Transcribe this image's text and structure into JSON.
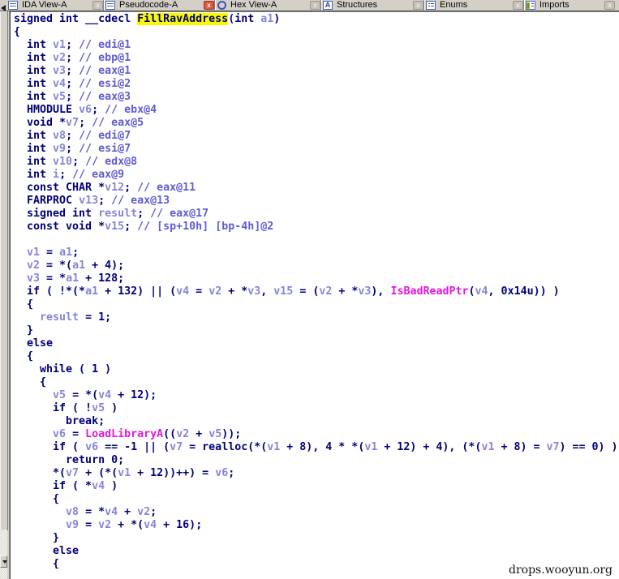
{
  "watermark": "drops.wooyun.org",
  "colors": {
    "keyword": "#00007a",
    "variable": "#8784d8",
    "comment": "#5f5dd0",
    "import_func": "#e018e0",
    "highlight_bg": "#fbfb00",
    "tab_bg": "#d4d0c8",
    "code_bg": "#ffffff",
    "active_close": "#e2573f"
  },
  "tabs": [
    {
      "label": "IDA View-A",
      "icon": "doc-lines-icon",
      "close": "x",
      "active": false
    },
    {
      "label": "Pseudocode-A",
      "icon": "doc-lines-icon",
      "close": "x",
      "active": true
    },
    {
      "label": "Hex View-A",
      "icon": "hex-ring-icon",
      "close": "x",
      "active": false
    },
    {
      "label": "Structures",
      "icon": "structures-icon",
      "close": "x",
      "active": false
    },
    {
      "label": "Enums",
      "icon": "enum-list-icon",
      "close": "x",
      "active": false
    },
    {
      "label": "Imports",
      "icon": "imports-icon",
      "close": "x",
      "active": false
    }
  ],
  "function_name": "FillRavAddress",
  "code": {
    "lines": [
      [
        [
          "k",
          "signed int __cdecl "
        ],
        [
          "h",
          "FillRavAddress"
        ],
        [
          "k",
          "(int "
        ],
        [
          "v",
          "a1"
        ],
        [
          "k",
          ")"
        ]
      ],
      [
        [
          "k",
          "{"
        ]
      ],
      [
        [
          "k",
          "  int "
        ],
        [
          "v",
          "v1"
        ],
        [
          "k",
          "; "
        ],
        [
          "c",
          "// edi@1"
        ]
      ],
      [
        [
          "k",
          "  int "
        ],
        [
          "v",
          "v2"
        ],
        [
          "k",
          "; "
        ],
        [
          "c",
          "// ebp@1"
        ]
      ],
      [
        [
          "k",
          "  int "
        ],
        [
          "v",
          "v3"
        ],
        [
          "k",
          "; "
        ],
        [
          "c",
          "// eax@1"
        ]
      ],
      [
        [
          "k",
          "  int "
        ],
        [
          "v",
          "v4"
        ],
        [
          "k",
          "; "
        ],
        [
          "c",
          "// esi@2"
        ]
      ],
      [
        [
          "k",
          "  int "
        ],
        [
          "v",
          "v5"
        ],
        [
          "k",
          "; "
        ],
        [
          "c",
          "// eax@3"
        ]
      ],
      [
        [
          "k",
          "  HMODULE "
        ],
        [
          "v",
          "v6"
        ],
        [
          "k",
          "; "
        ],
        [
          "c",
          "// ebx@4"
        ]
      ],
      [
        [
          "k",
          "  void *"
        ],
        [
          "v",
          "v7"
        ],
        [
          "k",
          "; "
        ],
        [
          "c",
          "// eax@5"
        ]
      ],
      [
        [
          "k",
          "  int "
        ],
        [
          "v",
          "v8"
        ],
        [
          "k",
          "; "
        ],
        [
          "c",
          "// edi@7"
        ]
      ],
      [
        [
          "k",
          "  int "
        ],
        [
          "v",
          "v9"
        ],
        [
          "k",
          "; "
        ],
        [
          "c",
          "// esi@7"
        ]
      ],
      [
        [
          "k",
          "  int "
        ],
        [
          "v",
          "v10"
        ],
        [
          "k",
          "; "
        ],
        [
          "c",
          "// edx@8"
        ]
      ],
      [
        [
          "k",
          "  int "
        ],
        [
          "v",
          "i"
        ],
        [
          "k",
          "; "
        ],
        [
          "c",
          "// eax@9"
        ]
      ],
      [
        [
          "k",
          "  const CHAR *"
        ],
        [
          "v",
          "v12"
        ],
        [
          "k",
          "; "
        ],
        [
          "c",
          "// eax@11"
        ]
      ],
      [
        [
          "k",
          "  FARPROC "
        ],
        [
          "v",
          "v13"
        ],
        [
          "k",
          "; "
        ],
        [
          "c",
          "// eax@13"
        ]
      ],
      [
        [
          "k",
          "  signed int "
        ],
        [
          "v",
          "result"
        ],
        [
          "k",
          "; "
        ],
        [
          "c",
          "// eax@17"
        ]
      ],
      [
        [
          "k",
          "  const void *"
        ],
        [
          "v",
          "v15"
        ],
        [
          "k",
          "; "
        ],
        [
          "c",
          "// [sp+10h] [bp-4h]@2"
        ]
      ],
      [],
      [
        [
          "k",
          "  "
        ],
        [
          "v",
          "v1"
        ],
        [
          "k",
          " = "
        ],
        [
          "v",
          "a1"
        ],
        [
          "k",
          ";"
        ]
      ],
      [
        [
          "k",
          "  "
        ],
        [
          "v",
          "v2"
        ],
        [
          "k",
          " = *("
        ],
        [
          "v",
          "a1"
        ],
        [
          "k",
          " + 4);"
        ]
      ],
      [
        [
          "k",
          "  "
        ],
        [
          "v",
          "v3"
        ],
        [
          "k",
          " = *"
        ],
        [
          "v",
          "a1"
        ],
        [
          "k",
          " + 128;"
        ]
      ],
      [
        [
          "k",
          "  if ( !*(*"
        ],
        [
          "v",
          "a1"
        ],
        [
          "k",
          " + 132) || ("
        ],
        [
          "v",
          "v4"
        ],
        [
          "k",
          " = "
        ],
        [
          "v",
          "v2"
        ],
        [
          "k",
          " + *"
        ],
        [
          "v",
          "v3"
        ],
        [
          "k",
          ", "
        ],
        [
          "v",
          "v15"
        ],
        [
          "k",
          " = ("
        ],
        [
          "v",
          "v2"
        ],
        [
          "k",
          " + *"
        ],
        [
          "v",
          "v3"
        ],
        [
          "k",
          "), "
        ],
        [
          "m",
          "IsBadReadPtr"
        ],
        [
          "k",
          "("
        ],
        [
          "v",
          "v4"
        ],
        [
          "k",
          ", 0x14u)) )"
        ]
      ],
      [
        [
          "k",
          "  {"
        ]
      ],
      [
        [
          "k",
          "    "
        ],
        [
          "v",
          "result"
        ],
        [
          "k",
          " = 1;"
        ]
      ],
      [
        [
          "k",
          "  }"
        ]
      ],
      [
        [
          "k",
          "  else"
        ]
      ],
      [
        [
          "k",
          "  {"
        ]
      ],
      [
        [
          "k",
          "    while ( 1 )"
        ]
      ],
      [
        [
          "k",
          "    {"
        ]
      ],
      [
        [
          "k",
          "      "
        ],
        [
          "v",
          "v5"
        ],
        [
          "k",
          " = *("
        ],
        [
          "v",
          "v4"
        ],
        [
          "k",
          " + 12);"
        ]
      ],
      [
        [
          "k",
          "      if ( !"
        ],
        [
          "v",
          "v5"
        ],
        [
          "k",
          " )"
        ]
      ],
      [
        [
          "k",
          "        break;"
        ]
      ],
      [
        [
          "k",
          "      "
        ],
        [
          "v",
          "v6"
        ],
        [
          "k",
          " = "
        ],
        [
          "m",
          "LoadLibraryA"
        ],
        [
          "k",
          "(("
        ],
        [
          "v",
          "v2"
        ],
        [
          "k",
          " + "
        ],
        [
          "v",
          "v5"
        ],
        [
          "k",
          "));"
        ]
      ],
      [
        [
          "k",
          "      if ( "
        ],
        [
          "v",
          "v6"
        ],
        [
          "k",
          " == -1 || ("
        ],
        [
          "v",
          "v7"
        ],
        [
          "k",
          " = realloc(*("
        ],
        [
          "v",
          "v1"
        ],
        [
          "k",
          " + 8), 4 * *("
        ],
        [
          "v",
          "v1"
        ],
        [
          "k",
          " + 12) + 4), (*("
        ],
        [
          "v",
          "v1"
        ],
        [
          "k",
          " + 8) = "
        ],
        [
          "v",
          "v7"
        ],
        [
          "k",
          ") == 0) )"
        ]
      ],
      [
        [
          "k",
          "        return 0;"
        ]
      ],
      [
        [
          "k",
          "      *("
        ],
        [
          "v",
          "v7"
        ],
        [
          "k",
          " + (*("
        ],
        [
          "v",
          "v1"
        ],
        [
          "k",
          " + 12))++) = "
        ],
        [
          "v",
          "v6"
        ],
        [
          "k",
          ";"
        ]
      ],
      [
        [
          "k",
          "      if ( *"
        ],
        [
          "v",
          "v4"
        ],
        [
          "k",
          " )"
        ]
      ],
      [
        [
          "k",
          "      {"
        ]
      ],
      [
        [
          "k",
          "        "
        ],
        [
          "v",
          "v8"
        ],
        [
          "k",
          " = *"
        ],
        [
          "v",
          "v4"
        ],
        [
          "k",
          " + "
        ],
        [
          "v",
          "v2"
        ],
        [
          "k",
          ";"
        ]
      ],
      [
        [
          "k",
          "        "
        ],
        [
          "v",
          "v9"
        ],
        [
          "k",
          " = "
        ],
        [
          "v",
          "v2"
        ],
        [
          "k",
          " + *("
        ],
        [
          "v",
          "v4"
        ],
        [
          "k",
          " + 16);"
        ]
      ],
      [
        [
          "k",
          "      }"
        ]
      ],
      [
        [
          "k",
          "      else"
        ]
      ],
      [
        [
          "k",
          "      {"
        ]
      ]
    ]
  }
}
